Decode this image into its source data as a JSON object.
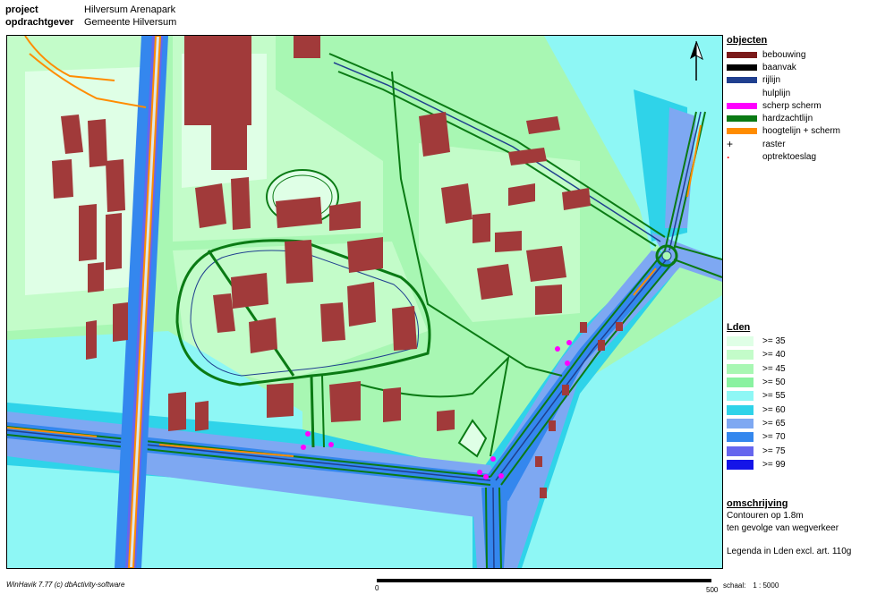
{
  "header": {
    "project_label": "project",
    "project_value": "Hilversum Arenapark",
    "client_label": "opdrachtgever",
    "client_value": "Gemeente Hilversum"
  },
  "legend_objects": {
    "title": "objecten",
    "items": [
      {
        "label": "bebouwing",
        "color": "#7a1a1a",
        "icon": "building-swatch"
      },
      {
        "label": "baanvak",
        "color": "#000000",
        "icon": "road-swatch"
      },
      {
        "label": "rijlijn",
        "color": "#1f3f8f",
        "icon": "driving-line-swatch"
      },
      {
        "label": "hulplijn",
        "color": "#ffffff",
        "icon": "auxiliary-line-swatch"
      },
      {
        "label": "scherp scherm",
        "color": "#ff00ff",
        "icon": "sharp-screen-swatch"
      },
      {
        "label": "hardzachtlijn",
        "color": "#0a7a14",
        "icon": "hard-soft-line-swatch"
      },
      {
        "label": "hoogtelijn + scherm",
        "color": "#ff8c00",
        "icon": "height-line-screen-swatch"
      },
      {
        "label": "raster",
        "symbol": "+",
        "icon": "grid-plus-icon"
      },
      {
        "label": "optrektoeslag",
        "symbol": "·",
        "icon": "pull-up-dot-icon",
        "color": "#ff0000"
      }
    ]
  },
  "legend_lden": {
    "title": "Lden",
    "items": [
      {
        "label": ">= 35",
        "color": "#dfffe6"
      },
      {
        "label": ">= 40",
        "color": "#c3fcc9"
      },
      {
        "label": ">= 45",
        "color": "#a8f7b3"
      },
      {
        "label": ">= 50",
        "color": "#89f2a0"
      },
      {
        "label": ">= 55",
        "color": "#8ef7f5"
      },
      {
        "label": ">= 60",
        "color": "#2fd3e9"
      },
      {
        "label": ">= 65",
        "color": "#7ea8f2"
      },
      {
        "label": ">= 70",
        "color": "#3487ee"
      },
      {
        "label": ">= 75",
        "color": "#6666ee"
      },
      {
        "label": ">= 99",
        "color": "#1414e8"
      }
    ]
  },
  "description": {
    "title": "omschrijving",
    "line1": "Contouren op 1.8m",
    "line2": "ten gevolge van wegverkeer",
    "line3": "Legenda in Lden excl. art. 110g"
  },
  "footer": {
    "software": "WinHavik 7.77 (c) dbActivity-software",
    "scale_start": "0",
    "scale_end": "500",
    "scale_label": "schaal:",
    "scale_value": "1 : 5000"
  },
  "map": {
    "north_arrow": "north-arrow-icon"
  }
}
